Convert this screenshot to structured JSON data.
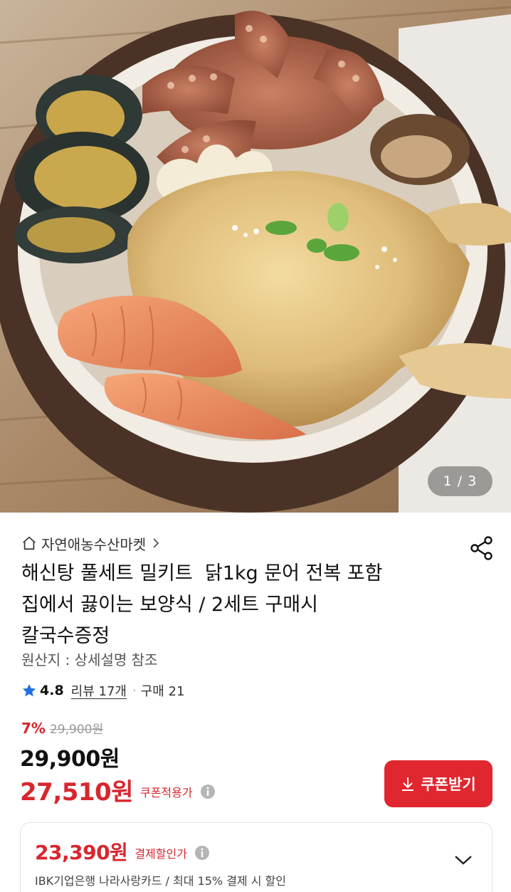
{
  "hero": {
    "counter": "1 / 3"
  },
  "store": {
    "name": "자연애농수산마켓",
    "home_icon": "home-icon",
    "chevron_icon": "chevron-right-icon"
  },
  "share_icon": "share-icon",
  "product": {
    "title": "해신탕 풀세트 밀키트  닭1kg 문어 전복 포함\n집에서 끓이는 보양식 / 2세트 구매시\n칼국수증정",
    "origin": "원산지 : 상세설명 참조"
  },
  "rating": {
    "score": "4.8",
    "reviews": "리뷰 17개",
    "separator": "·",
    "purchases": "구매 21",
    "star_color": "#1e6fe0"
  },
  "pricing": {
    "discount_percent": "7%",
    "original_price": "29,900원",
    "price": "29,900원",
    "coupon_price": "27,510원",
    "coupon_label": "쿠폰적용가",
    "coupon_button": "쿠폰받기",
    "accent_color": "#d8262e"
  },
  "payment_discount": {
    "price": "23,390원",
    "label": "결제할인가",
    "description": "IBK기업은행 나라사랑카드 / 최대 15% 결제 시 할인"
  }
}
